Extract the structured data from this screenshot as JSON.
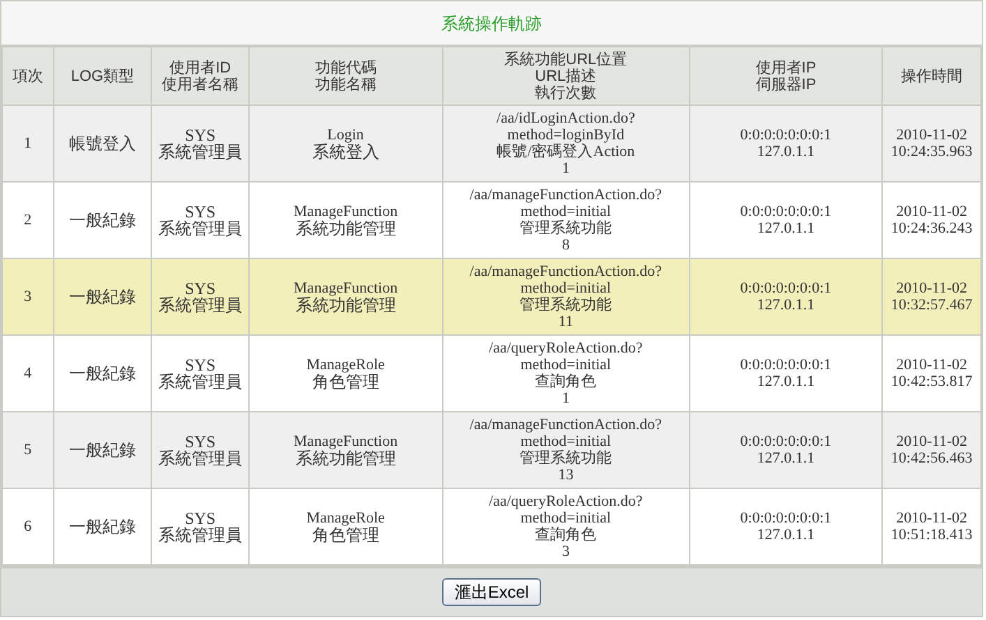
{
  "title": "系統操作軌跡",
  "columns": [
    [
      "項次"
    ],
    [
      "LOG類型"
    ],
    [
      "使用者ID",
      "使用者名稱"
    ],
    [
      "功能代碼",
      "功能名稱"
    ],
    [
      "系統功能URL位置",
      "URL描述",
      "執行次數"
    ],
    [
      "使用者IP",
      "伺服器IP"
    ],
    [
      "操作時間"
    ]
  ],
  "rows": [
    {
      "selected": false,
      "index": "1",
      "log_type": "帳號登入",
      "user_id": "SYS",
      "user_name": "系統管理員",
      "function_code": "Login",
      "function_name": "系統登入",
      "url": [
        "/aa/idLoginAction.do?",
        "method=loginById"
      ],
      "url_description": "帳號/密碼登入Action",
      "count": "1",
      "user_ip": "0:0:0:0:0:0:0:1",
      "server_ip": "127.0.1.1",
      "date": "2010-11-02",
      "time": "10:24:35.963"
    },
    {
      "selected": false,
      "index": "2",
      "log_type": "一般紀錄",
      "user_id": "SYS",
      "user_name": "系統管理員",
      "function_code": "ManageFunction",
      "function_name": "系統功能管理",
      "url": [
        "/aa/manageFunctionAction.do?",
        "method=initial"
      ],
      "url_description": "管理系統功能",
      "count": "8",
      "user_ip": "0:0:0:0:0:0:0:1",
      "server_ip": "127.0.1.1",
      "date": "2010-11-02",
      "time": "10:24:36.243"
    },
    {
      "selected": true,
      "index": "3",
      "log_type": "一般紀錄",
      "user_id": "SYS",
      "user_name": "系統管理員",
      "function_code": "ManageFunction",
      "function_name": "系統功能管理",
      "url": [
        "/aa/manageFunctionAction.do?",
        "method=initial"
      ],
      "url_description": "管理系統功能",
      "count": "11",
      "user_ip": "0:0:0:0:0:0:0:1",
      "server_ip": "127.0.1.1",
      "date": "2010-11-02",
      "time": "10:32:57.467"
    },
    {
      "selected": false,
      "index": "4",
      "log_type": "一般紀錄",
      "user_id": "SYS",
      "user_name": "系統管理員",
      "function_code": "ManageRole",
      "function_name": "角色管理",
      "url": [
        "/aa/queryRoleAction.do?",
        "method=initial"
      ],
      "url_description": "查詢角色",
      "count": "1",
      "user_ip": "0:0:0:0:0:0:0:1",
      "server_ip": "127.0.1.1",
      "date": "2010-11-02",
      "time": "10:42:53.817"
    },
    {
      "selected": false,
      "index": "5",
      "log_type": "一般紀錄",
      "user_id": "SYS",
      "user_name": "系統管理員",
      "function_code": "ManageFunction",
      "function_name": "系統功能管理",
      "url": [
        "/aa/manageFunctionAction.do?",
        "method=initial"
      ],
      "url_description": "管理系統功能",
      "count": "13",
      "user_ip": "0:0:0:0:0:0:0:1",
      "server_ip": "127.0.1.1",
      "date": "2010-11-02",
      "time": "10:42:56.463"
    },
    {
      "selected": false,
      "index": "6",
      "log_type": "一般紀錄",
      "user_id": "SYS",
      "user_name": "系統管理員",
      "function_code": "ManageRole",
      "function_name": "角色管理",
      "url": [
        "/aa/queryRoleAction.do?",
        "method=initial"
      ],
      "url_description": "查詢角色",
      "count": "3",
      "user_ip": "0:0:0:0:0:0:0:1",
      "server_ip": "127.0.1.1",
      "date": "2010-11-02",
      "time": "10:51:18.413"
    }
  ],
  "export_button": "滙出Excel"
}
